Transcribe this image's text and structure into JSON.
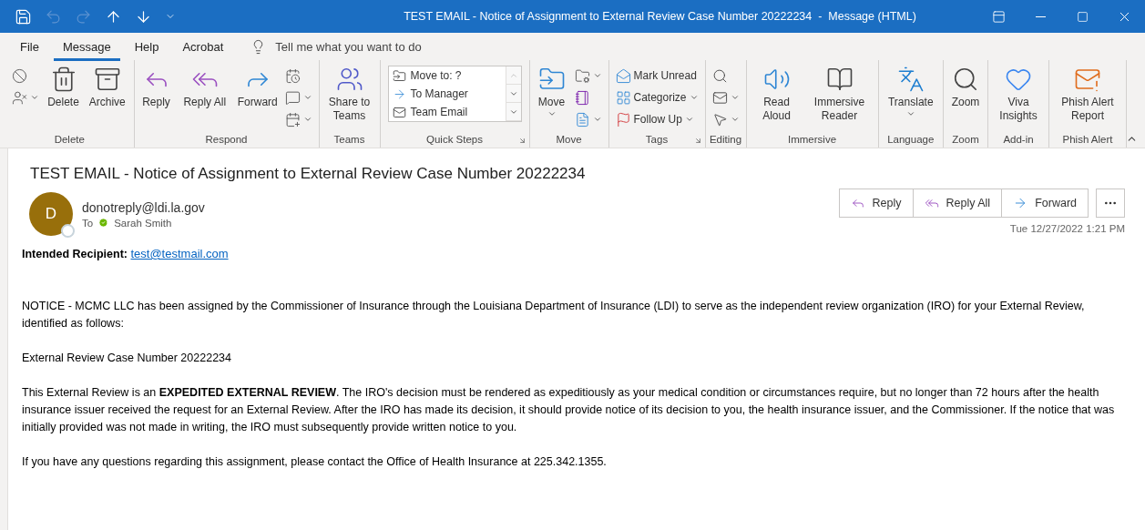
{
  "window": {
    "title": "TEST EMAIL - Notice of Assignment to External Review Case Number 20222234  -  Message (HTML)",
    "quick_access": [
      {
        "disabled": false
      },
      {
        "disabled": true
      },
      {
        "disabled": true
      },
      {
        "disabled": false
      },
      {
        "disabled": false
      },
      {
        "disabled": false
      }
    ]
  },
  "menu_tabs": [
    {
      "label": "File",
      "selected": false
    },
    {
      "label": "Message",
      "selected": true
    },
    {
      "label": "Help",
      "selected": false
    },
    {
      "label": "Acrobat",
      "selected": false
    }
  ],
  "tell_me": {
    "placeholder": "Tell me what you want to do"
  },
  "ribbon_groups": [
    {
      "label": "Delete",
      "columns": [
        {
          "kind": "stack",
          "items": [
            {
              "dropdown": false
            },
            {
              "dropdown": true
            }
          ]
        },
        {
          "kind": "large",
          "label": "Delete"
        },
        {
          "kind": "large",
          "label": "Archive"
        }
      ]
    },
    {
      "label": "Respond",
      "columns": [
        {
          "kind": "large",
          "label": "Reply"
        },
        {
          "kind": "large",
          "label": "Reply All"
        },
        {
          "kind": "large",
          "label": "Forward"
        },
        {
          "kind": "stack",
          "items": [
            {
              "dropdown": false
            },
            {
              "dropdown": true
            },
            {
              "dropdown": true
            }
          ]
        }
      ]
    },
    {
      "label": "Teams",
      "columns": [
        {
          "kind": "large",
          "label": "Share to Teams"
        }
      ]
    },
    {
      "label": "Quick Steps",
      "launcher": true,
      "columns": [
        {
          "kind": "gallery",
          "items": [
            {
              "label": "Move to: ?"
            },
            {
              "label": "To Manager"
            },
            {
              "label": "Team Email"
            }
          ]
        }
      ]
    },
    {
      "label": "Move",
      "columns": [
        {
          "kind": "large",
          "label": "Move",
          "dropdown": true
        },
        {
          "kind": "stack",
          "items": [
            {
              "dropdown": true
            },
            {
              "dropdown": false
            },
            {
              "dropdown": true
            }
          ]
        }
      ]
    },
    {
      "label": "Tags",
      "launcher": true,
      "columns": [
        {
          "kind": "stack",
          "items": [
            {
              "label": "Mark Unread",
              "dropdown": false
            },
            {
              "label": "Categorize",
              "dropdown": true
            },
            {
              "label": "Follow Up",
              "dropdown": true
            }
          ]
        }
      ]
    },
    {
      "label": "Editing",
      "columns": [
        {
          "kind": "stack",
          "items": [
            {
              "dropdown": false
            },
            {
              "dropdown": true
            },
            {
              "dropdown": true
            }
          ]
        }
      ]
    },
    {
      "label": "Immersive",
      "columns": [
        {
          "kind": "large",
          "label": "Read Aloud"
        },
        {
          "kind": "large",
          "label": "Immersive Reader"
        }
      ]
    },
    {
      "label": "Language",
      "columns": [
        {
          "kind": "large",
          "label": "Translate",
          "dropdown": true
        }
      ]
    },
    {
      "label": "Zoom",
      "columns": [
        {
          "kind": "large",
          "label": "Zoom"
        }
      ]
    },
    {
      "label": "Add-in",
      "columns": [
        {
          "kind": "large",
          "label": "Viva Insights"
        }
      ]
    },
    {
      "label": "Phish Alert",
      "columns": [
        {
          "kind": "large",
          "label": "Phish Alert Report"
        }
      ]
    }
  ],
  "message": {
    "subject": "TEST EMAIL - Notice of Assignment to External Review Case Number 20222234",
    "avatar": "D",
    "sender": "donotreply@ldi.la.gov",
    "to_label": "To",
    "recipient": "Sarah Smith",
    "actions": [
      {
        "kind": "reply",
        "label": "Reply"
      },
      {
        "kind": "replyall",
        "label": "Reply All"
      },
      {
        "kind": "forward",
        "label": "Forward"
      }
    ],
    "date": "Tue 12/27/2022 1:21 PM"
  },
  "body": [
    {
      "kind": "field",
      "label": "Intended Recipient:",
      "link": "test@testmail.com"
    },
    {
      "kind": "text",
      "text": "NOTICE - MCMC LLC has been assigned by the Commissioner of Insurance through the Louisiana Department of Insurance (LDI) to serve as the independent review organization (IRO) for your External Review, identified as follows:"
    },
    {
      "kind": "text",
      "text": "External Review Case Number 20222234"
    },
    {
      "kind": "text",
      "text": "This External Review is an **EXPEDITED EXTERNAL REVIEW**. The IRO's decision must be rendered as expeditiously as your medical condition or circumstances require, but no longer than 72 hours after the health insurance issuer received the request for an External Review. After the IRO has made its decision, it should provide notice of its decision to you, the health insurance issuer, and the Commissioner. If the notice that was initially provided was not made in writing, the IRO must subsequently provide written notice to you."
    },
    {
      "kind": "text",
      "text": "If you have any questions regarding this assignment, please contact the Office of Health Insurance at 225.342.1355."
    }
  ]
}
